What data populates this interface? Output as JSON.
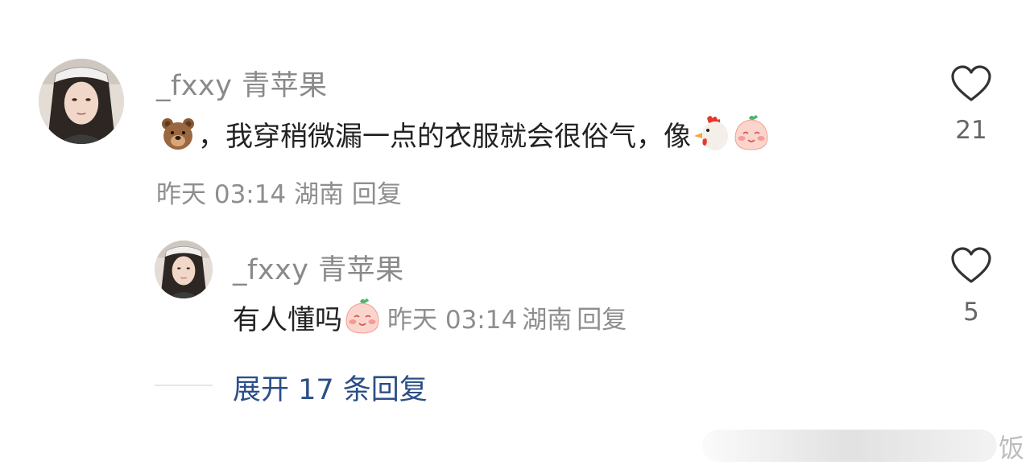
{
  "comment": {
    "username": "_fxxy 青苹果",
    "text": "，我穿稍微漏一点的衣服就会很俗气，像",
    "emojis": [
      "bear-emoji",
      "rooster-emoji",
      "blushing-face-emoji"
    ],
    "time": "昨天 03:14",
    "location": "湖南",
    "reply_label": "回复",
    "like_count": "21"
  },
  "reply": {
    "username": "_fxxy 青苹果",
    "text": "有人懂吗",
    "emojis": [
      "blushing-face-emoji"
    ],
    "time": "昨天 03:14",
    "location": "湖南",
    "reply_label": "回复",
    "like_count": "5"
  },
  "expand": {
    "label": "展开 17 条回复"
  },
  "watermark": {
    "char": "饭"
  },
  "colors": {
    "username": "#8a8a8a",
    "text": "#222222",
    "meta": "#8e8e8e",
    "expand_link": "#2b4f86",
    "heart_outline": "#333333"
  },
  "icons": {
    "like": "heart-outline-icon"
  }
}
